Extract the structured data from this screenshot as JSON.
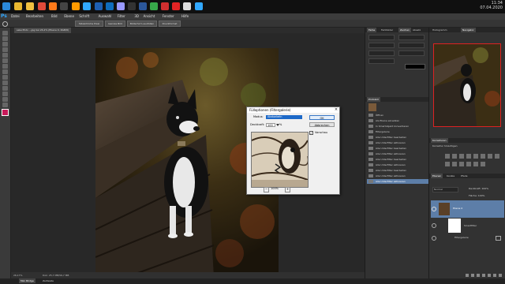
{
  "taskbar": {
    "clock_time": "11:34",
    "clock_date": "07.04.2020",
    "apps": [
      {
        "name": "start",
        "color": "#2b88d8"
      },
      {
        "name": "explorer",
        "color": "#e8b730"
      },
      {
        "name": "folder",
        "color": "#f0c040"
      },
      {
        "name": "chrome",
        "color": "#e04b3a"
      },
      {
        "name": "firefox",
        "color": "#ff7a1a"
      },
      {
        "name": "app-dark",
        "color": "#444444"
      },
      {
        "name": "illustrator",
        "color": "#ff9a00"
      },
      {
        "name": "photoshop",
        "color": "#31a8ff"
      },
      {
        "name": "app-blue",
        "color": "#1e5fb3"
      },
      {
        "name": "outlook",
        "color": "#0f6cbd"
      },
      {
        "name": "premiere",
        "color": "#9999ff"
      },
      {
        "name": "app-dark2",
        "color": "#333333"
      },
      {
        "name": "word",
        "color": "#2b579a"
      },
      {
        "name": "app-green",
        "color": "#37a84a"
      },
      {
        "name": "app-red",
        "color": "#cf2f2f"
      },
      {
        "name": "acrobat",
        "color": "#e22424"
      },
      {
        "name": "app-white",
        "color": "#dddddd"
      },
      {
        "name": "lightroom",
        "color": "#31a8ff"
      }
    ]
  },
  "menubar": {
    "logo": "Ps",
    "items": [
      "Datei",
      "Bearbeiten",
      "Bild",
      "Ebene",
      "Schrift",
      "Auswahl",
      "Filter",
      "3D",
      "Ansicht",
      "Fenster",
      "Hilfe"
    ]
  },
  "optionsbar": {
    "buttons": [
      "Tatsächliche Pixel",
      "Ganzes Bild",
      "Bildschirm ausfüllen",
      "Druckformat"
    ]
  },
  "document": {
    "tab_title": "selectfoto ...jpg bei 26,2% (Ebene 0, RGB/8)",
    "zoom": "26,17%",
    "doc_size": "Dok: 25,7 MB/56,7 MB"
  },
  "bottom_tabs": [
    "Mini Bridge",
    "Zeitleiste"
  ],
  "panels": {
    "color_tabs": [
      "Farbe",
      "Farbfelder"
    ],
    "char_tabs": [
      "Zeichen",
      "Absatz"
    ],
    "navigator_tabs": [
      "Histogramm",
      "Navigator"
    ],
    "history_title": "Protokoll",
    "history_items": [
      "Öffnen",
      "Als Ebene einsetzen",
      "In Smartobjekt konvertieren",
      "Filtergalerie",
      "Alle Unterfilter bearbeiten",
      "Alle Unterfilter aktivieren",
      "Alle Unterfilter bearbeiten",
      "Alle Unterfilter aktivieren",
      "Alle Unterfilter bearbeiten",
      "Alle Unterfilter aktivieren",
      "Alle Unterfilter bearbeiten",
      "Alle Unterfilter aktivieren",
      "Alle Unterfilter aktivieren"
    ],
    "history_selected_index": 12,
    "adjustments_title": "Korrekturen",
    "adjustments_subtitle": "Korrektur hinzufügen",
    "layers_tabs": [
      "Ebenen",
      "Kanäle",
      "Pfade"
    ],
    "layers_blend": "Normal",
    "layers_opacity": "Deckkraft: 100%",
    "layers_fill": "Fläche: 100%",
    "layers": [
      {
        "name": "Ebene 0",
        "selected": true
      },
      {
        "name": "Smartfilter",
        "selected": false
      },
      {
        "name": "Filtergalerie",
        "selected": false
      }
    ]
  },
  "dialog": {
    "title": "Fülloptionen (Filtergalerie)",
    "mode_label": "Modus:",
    "mode_value": "Abdunkeln",
    "opacity_label": "Deckkraft:",
    "opacity_value": "100",
    "opacity_unit": "%",
    "ok_label": "OK",
    "cancel_label": "Abbrechen",
    "preview_label": "Vorschau",
    "preview_checked": true,
    "zoom": "100%"
  },
  "colors": {
    "foreground": "#c81a5a",
    "background": "#e84b8a",
    "selection": "#5d7ea8"
  }
}
